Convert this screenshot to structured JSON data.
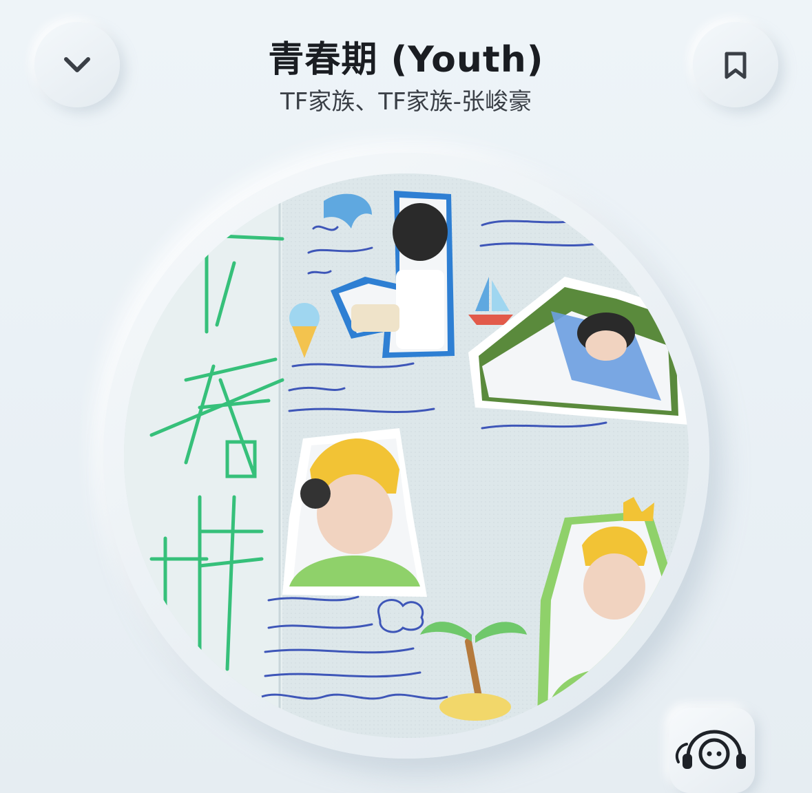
{
  "header": {
    "collapse_icon": "chevron-down-icon",
    "bookmark_icon": "bookmark-icon",
    "song_title": "青春期 (Youth)",
    "artists": "TF家族、TF家族-张峻豪"
  },
  "album_art": {
    "icon": "album-cover",
    "accent_colors": [
      "#2fbf6a",
      "#2f5fc8",
      "#f2c335",
      "#8fd16a"
    ]
  },
  "assistant": {
    "icon": "headphone-bot-icon"
  }
}
